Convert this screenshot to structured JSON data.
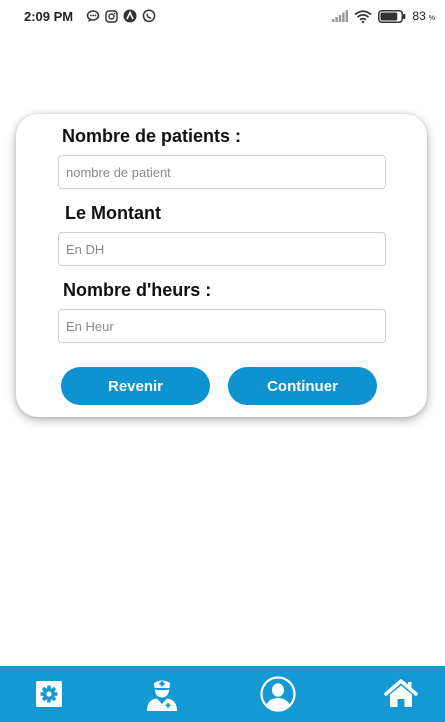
{
  "status_bar": {
    "time": "2:09 PM",
    "left_icons": [
      "chat-bubble-icon",
      "instagram-icon",
      "arc-app-icon",
      "whatsapp-icon"
    ],
    "right_icons": [
      "signal-icon",
      "wifi-icon",
      "battery-icon"
    ],
    "battery_level": "83",
    "battery_unit": "%"
  },
  "form": {
    "patients_label": "Nombre de patients :",
    "patients_placeholder": "nombre de patient",
    "amount_label": "Le Montant",
    "amount_placeholder": "En DH",
    "hours_label": "Nombre d'heurs :",
    "hours_placeholder": "En Heur",
    "back_button": "Revenir",
    "continue_button": "Continuer"
  },
  "bottom_nav": {
    "items": [
      {
        "icon": "settings-icon"
      },
      {
        "icon": "nurse-icon"
      },
      {
        "icon": "profile-icon"
      },
      {
        "icon": "home-icon"
      }
    ]
  },
  "colors": {
    "accent": "#0e93d0",
    "nav_background": "#1499d3",
    "card_background": "#ffffff",
    "page_background": "#ffffff"
  }
}
